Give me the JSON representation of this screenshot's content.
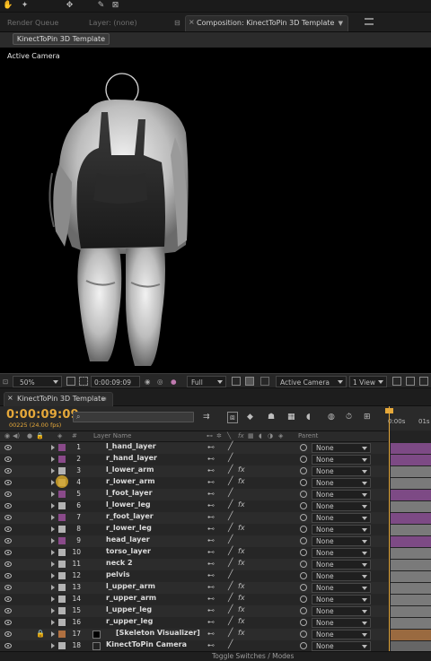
{
  "toolbar": {
    "icons": [
      "hand-icon",
      "rotate-icon",
      "move-icon",
      "pen-icon",
      "close-icon"
    ]
  },
  "panel_tabs": {
    "render_queue": "Render Queue",
    "layer_tab": "Layer: (none)",
    "composition_tab": "Composition: KinectToPin 3D Template"
  },
  "comp_name_button": "KinectToPin 3D Template",
  "viewer": {
    "camera_label": "Active Camera"
  },
  "viewer_footer": {
    "zoom": "50%",
    "timecode": "0:00:09:09",
    "resolution": "Full",
    "camera": "Active Camera",
    "view_layout": "1 View"
  },
  "timeline": {
    "tab_title": "KinectToPin 3D Template",
    "tab_menu": "≡",
    "current_time": "0:00:09:09",
    "frame_info": "00225 (24.00 fps)",
    "search_placeholder": "",
    "columns": {
      "layer_name": "Layer Name",
      "parent": "Parent",
      "num": "#"
    },
    "ruler": [
      "0:00s",
      "01s"
    ],
    "layers": [
      {
        "num": "1",
        "name": "l_hand_layer",
        "label_color": "#8a4a8a",
        "fx": false,
        "bar_color": "#7d4a85"
      },
      {
        "num": "2",
        "name": "r_hand_layer",
        "label_color": "#8a4a8a",
        "fx": false,
        "bar_color": "#7d4a85"
      },
      {
        "num": "3",
        "name": "l_lower_arm",
        "label_color": "#b3b3b3",
        "fx": true,
        "bar_color": "#7a7a7a"
      },
      {
        "num": "4",
        "name": "r_lower_arm",
        "label_color": "#b3b3b3",
        "fx": true,
        "bar_color": "#7a7a7a"
      },
      {
        "num": "5",
        "name": "l_foot_layer",
        "label_color": "#8a4a8a",
        "fx": false,
        "bar_color": "#7d4a85"
      },
      {
        "num": "6",
        "name": "l_lower_leg",
        "label_color": "#b3b3b3",
        "fx": true,
        "bar_color": "#7a7a7a"
      },
      {
        "num": "7",
        "name": "r_foot_layer",
        "label_color": "#8a4a8a",
        "fx": false,
        "bar_color": "#7d4a85"
      },
      {
        "num": "8",
        "name": "r_lower_leg",
        "label_color": "#b3b3b3",
        "fx": true,
        "bar_color": "#7a7a7a"
      },
      {
        "num": "9",
        "name": "head_layer",
        "label_color": "#8a4a8a",
        "fx": false,
        "bar_color": "#7d4a85"
      },
      {
        "num": "10",
        "name": "torso_layer",
        "label_color": "#b3b3b3",
        "fx": true,
        "bar_color": "#7a7a7a"
      },
      {
        "num": "11",
        "name": "neck 2",
        "label_color": "#b3b3b3",
        "fx": true,
        "bar_color": "#7a7a7a"
      },
      {
        "num": "12",
        "name": "pelvis",
        "label_color": "#b3b3b3",
        "fx": false,
        "bar_color": "#7a7a7a"
      },
      {
        "num": "13",
        "name": "l_upper_arm",
        "label_color": "#b3b3b3",
        "fx": true,
        "bar_color": "#7a7a7a"
      },
      {
        "num": "14",
        "name": "r_upper_arm",
        "label_color": "#b3b3b3",
        "fx": true,
        "bar_color": "#7a7a7a"
      },
      {
        "num": "15",
        "name": "l_upper_leg",
        "label_color": "#b3b3b3",
        "fx": true,
        "bar_color": "#7a7a7a"
      },
      {
        "num": "16",
        "name": "r_upper_leg",
        "label_color": "#b3b3b3",
        "fx": true,
        "bar_color": "#7a7a7a"
      },
      {
        "num": "17",
        "name": "[Skeleton Visualizer]",
        "label_color": "#b07040",
        "fx": true,
        "bar_color": "#9a6a40"
      },
      {
        "num": "18",
        "name": "KinectToPin Camera",
        "label_color": "#b3b3b3",
        "fx": false,
        "bar_color": "#666666"
      }
    ],
    "parent_value": "None",
    "footer_toggle": "Toggle Switches / Modes"
  }
}
